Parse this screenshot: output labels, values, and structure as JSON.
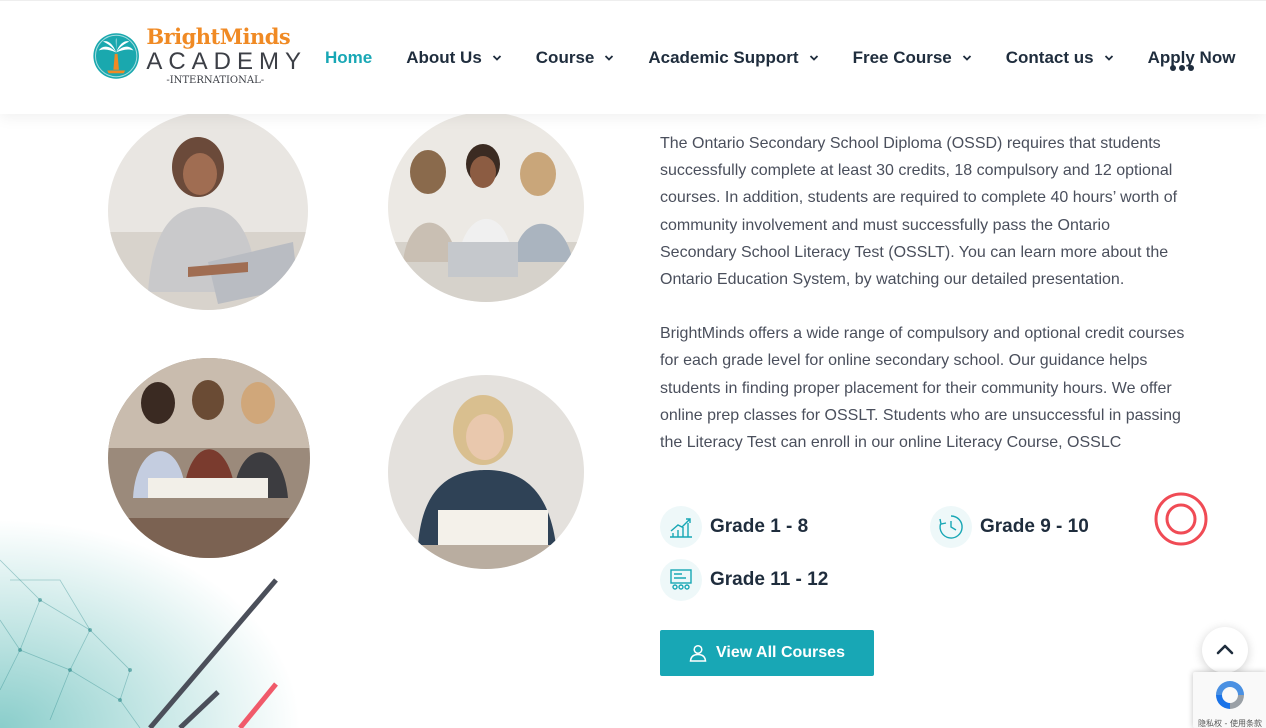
{
  "header": {
    "logo": {
      "brand": "BrightMinds",
      "academy": "ACADEMY",
      "tagline": "-INTERNATIONAL-"
    },
    "nav": [
      {
        "label": "Home",
        "active": true,
        "dropdown": false
      },
      {
        "label": "About Us",
        "active": false,
        "dropdown": true
      },
      {
        "label": "Course",
        "active": false,
        "dropdown": true
      },
      {
        "label": "Academic Support",
        "active": false,
        "dropdown": true
      },
      {
        "label": "Free Course",
        "active": false,
        "dropdown": true
      },
      {
        "label": "Contact us",
        "active": false,
        "dropdown": true
      },
      {
        "label": "Apply Now",
        "active": false,
        "dropdown": false
      }
    ],
    "more_icon": "more-dots-icon"
  },
  "content": {
    "paragraph_1": "The Ontario Secondary School Diploma (OSSD) requires that students successfully complete at least 30 credits, 18 compulsory and 12 optional courses. In addition, students are required to complete 40 hours’ worth of community involvement and must successfully pass the Ontario Secondary School Literacy Test (OSSLT). You can learn more about the Ontario Education System, by watching our detailed presentation.",
    "paragraph_2": "BrightMinds offers a wide range of compulsory and optional credit courses for each grade level for online secondary school. Our guidance helps students in finding proper placement for their community hours. We offer online prep classes for OSSLT. Students who are unsuccessful in passing the Literacy Test can enroll in our online Literacy Course, OSSLC",
    "grades": [
      {
        "label": "Grade 1 - 8",
        "icon": "growth-chart-icon"
      },
      {
        "label": "Grade 9 - 10",
        "icon": "clock-icon"
      },
      {
        "label": "Grade 11 - 12",
        "icon": "classroom-icon"
      }
    ],
    "cta_label": "View All Courses"
  },
  "recaptcha": {
    "text": "隐私权 - 使用条款"
  },
  "colors": {
    "accent": "#18a7b5",
    "brand_orange": "#f08a24",
    "heading": "#1f2d3d",
    "body_text": "#4a4f5c",
    "ring": "#f04b55"
  }
}
